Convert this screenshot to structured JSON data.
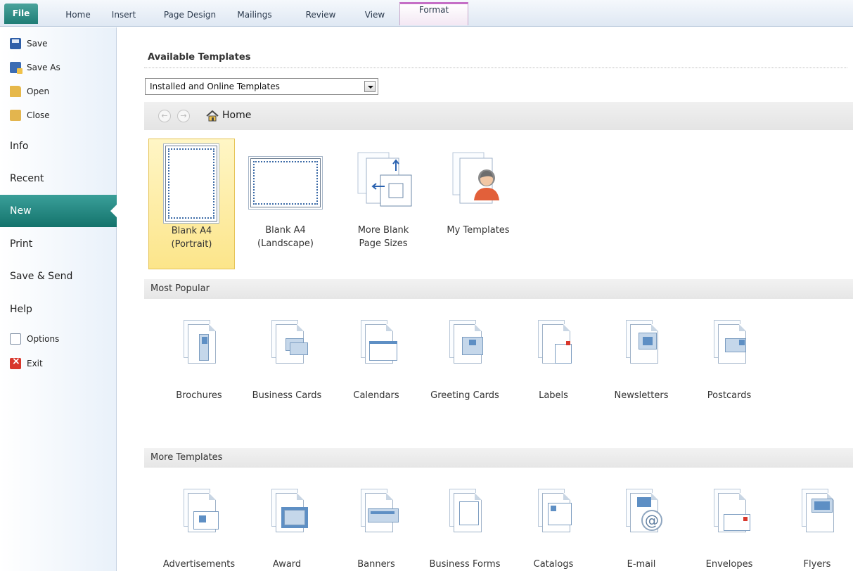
{
  "ribbon": {
    "tabs": [
      "File",
      "Home",
      "Insert",
      "Page Design",
      "Mailings",
      "Review",
      "View",
      "Format"
    ]
  },
  "backstage": {
    "commands": [
      {
        "label": "Save",
        "icon": "save-icon"
      },
      {
        "label": "Save As",
        "icon": "save-as-icon"
      },
      {
        "label": "Open",
        "icon": "open-folder-icon"
      },
      {
        "label": "Close",
        "icon": "close-folder-icon"
      }
    ],
    "nav": [
      "Info",
      "Recent",
      "New",
      "Print",
      "Save & Send",
      "Help"
    ],
    "selected_nav": "New",
    "bottom_commands": [
      {
        "label": "Options",
        "icon": "options-icon"
      },
      {
        "label": "Exit",
        "icon": "exit-icon"
      }
    ]
  },
  "main": {
    "heading": "Available Templates",
    "template_source": "Installed and Online Templates",
    "breadcrumb_home": "Home",
    "blank_tiles": [
      {
        "line1": "Blank A4",
        "line2": "(Portrait)"
      },
      {
        "line1": "Blank A4",
        "line2": "(Landscape)"
      },
      {
        "line1": "More Blank",
        "line2": "Page Sizes"
      },
      {
        "line1": "My Templates",
        "line2": ""
      }
    ],
    "most_popular_header": "Most Popular",
    "most_popular": [
      "Brochures",
      "Business Cards",
      "Calendars",
      "Greeting Cards",
      "Labels",
      "Newsletters",
      "Postcards"
    ],
    "more_templates_header": "More Templates",
    "more_templates": [
      "Advertisements",
      "Award",
      "Banners",
      "Business Forms",
      "Catalogs",
      "E-mail",
      "Envelopes",
      "Flyers"
    ]
  },
  "colors": {
    "file_tab": "#1f7d76",
    "selected_nav": "#14736c",
    "selected_tile": "#fce58a",
    "format_tab_accent": "#c56fc6"
  }
}
